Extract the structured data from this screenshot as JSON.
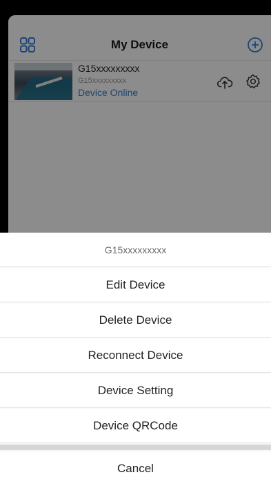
{
  "header": {
    "title": "My Device"
  },
  "device": {
    "name": "G15xxxxxxxxx",
    "subtitle": "G15xxxxxxxxx",
    "status": "Device Online"
  },
  "sheet": {
    "title": "G15xxxxxxxxx",
    "items": [
      "Edit Device",
      "Delete Device",
      "Reconnect Device",
      "Device Setting",
      "Device QRCode"
    ],
    "cancel": "Cancel"
  },
  "colors": {
    "accent": "#2f7fd6",
    "overlay": "rgba(0,0,0,0.45)"
  },
  "icons": [
    "grid-icon",
    "add-circle-icon",
    "cloud-upload-icon",
    "gear-icon"
  ]
}
